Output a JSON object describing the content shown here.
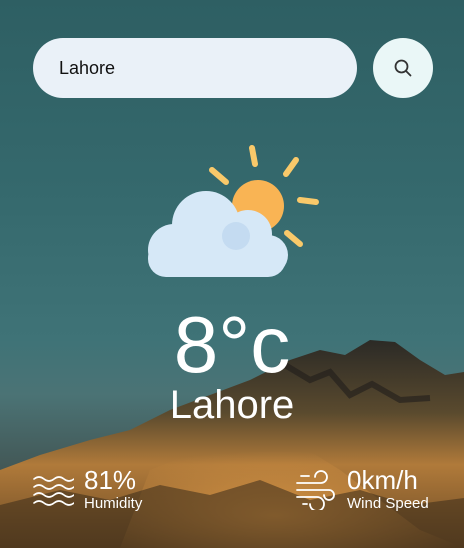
{
  "search": {
    "value": "Lahore",
    "button_icon": "search-icon"
  },
  "weather": {
    "icon": "partly-cloudy-icon",
    "temperature": "8°c",
    "city": "Lahore"
  },
  "details": {
    "humidity": {
      "icon": "humidity-waves-icon",
      "value": "81%",
      "label": "Humidity"
    },
    "wind": {
      "icon": "wind-icon",
      "value": "0km/h",
      "label": "Wind Speed"
    }
  },
  "colors": {
    "sky_teal": "#2e5f63",
    "search_bg": "#eaf1f8",
    "sun": "#f9b454",
    "cloud": "#d6e8f7",
    "text": "#ffffff"
  }
}
